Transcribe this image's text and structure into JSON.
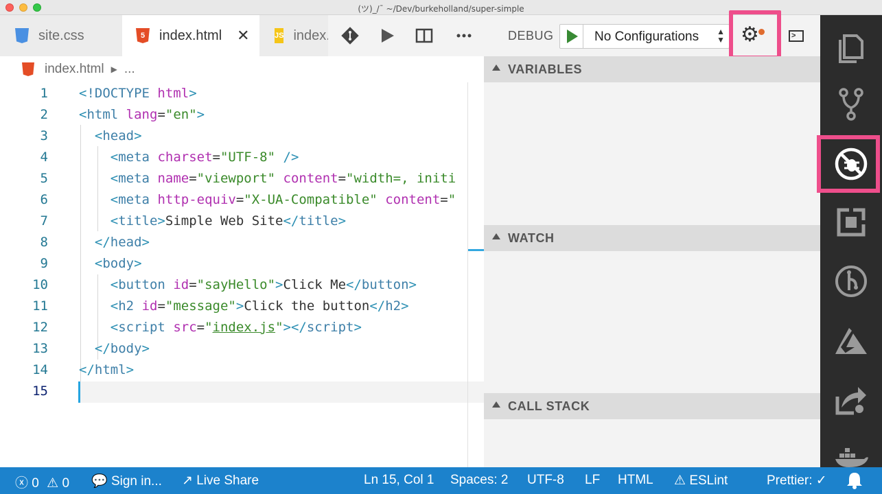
{
  "window": {
    "title": "(ツ)_/¯ ~/Dev/burkeholland/super-simple"
  },
  "tabs": [
    {
      "label": "site.css",
      "icon": "css-file-icon"
    },
    {
      "label": "index.html",
      "icon": "html-file-icon",
      "close": "✕"
    },
    {
      "label": "index.js",
      "icon": "js-file-icon"
    }
  ],
  "file_icons": {
    "css": "CSS",
    "html": "5",
    "js": "JS"
  },
  "debug": {
    "label": "DEBUG",
    "configuration": "No Configurations"
  },
  "breadcrumb": {
    "file": "index.html",
    "more": "..."
  },
  "editor": {
    "line_numbers": [
      "1",
      "2",
      "3",
      "4",
      "5",
      "6",
      "7",
      "8",
      "9",
      "10",
      "11",
      "12",
      "13",
      "14",
      "15"
    ]
  },
  "panels": {
    "variables": "VARIABLES",
    "watch": "WATCH",
    "call_stack": "CALL STACK"
  },
  "status": {
    "errors": "0",
    "warnings": "0",
    "sign_in": "Sign in...",
    "live_share": "Live Share",
    "position": "Ln 15, Col 1",
    "spaces": "Spaces: 2",
    "encoding": "UTF-8",
    "eol": "LF",
    "language": "HTML",
    "eslint": "ESLint",
    "prettier": "Prettier: ✓"
  },
  "colors": {
    "accent_pink": "#ee4e8b",
    "status_blue": "#1c82cc",
    "activity_bg": "#2c2c2c"
  }
}
